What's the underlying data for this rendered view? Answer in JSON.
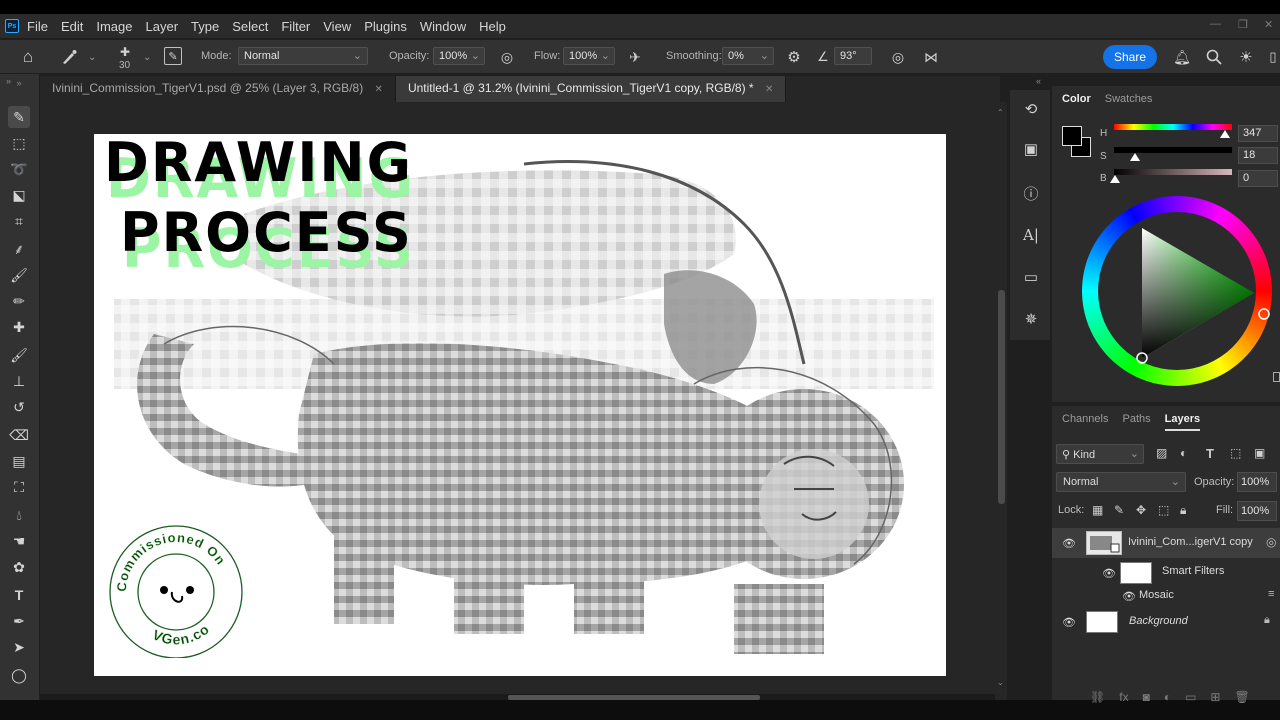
{
  "menubar": {
    "logo": "Ps",
    "items": [
      "File",
      "Edit",
      "Image",
      "Layer",
      "Type",
      "Select",
      "Filter",
      "View",
      "Plugins",
      "Window",
      "Help"
    ]
  },
  "options": {
    "brush_size": "30",
    "mode_label": "Mode:",
    "mode_value": "Normal",
    "opacity_label": "Opacity:",
    "opacity_value": "100%",
    "flow_label": "Flow:",
    "flow_value": "100%",
    "smoothing_label": "Smoothing:",
    "smoothing_value": "0%",
    "angle_value": "93°",
    "share_label": "Share"
  },
  "tabs": [
    {
      "label": "Ivinini_Commission_TigerV1.psd @ 25% (Layer 3, RGB/8)",
      "active": false
    },
    {
      "label": "Untitled-1 @ 31.2% (Ivinini_Commission_TigerV1 copy, RGB/8) *",
      "active": true
    }
  ],
  "canvas": {
    "title_line1": "DRAWING",
    "title_line2": "PROCESS",
    "badge_top": "Commissioned On",
    "badge_bottom": "VGen.co"
  },
  "color_panel": {
    "tabs": [
      "Color",
      "Swatches"
    ],
    "h_label": "H",
    "h_value": "347",
    "s_label": "S",
    "s_value": "18",
    "b_label": "B",
    "b_value": "0"
  },
  "layers_panel": {
    "tabs": [
      "Channels",
      "Paths",
      "Layers"
    ],
    "kind_label": "Kind",
    "blend_mode": "Normal",
    "opacity_label": "Opacity:",
    "opacity_value": "100%",
    "lock_label": "Lock:",
    "fill_label": "Fill:",
    "fill_value": "100%",
    "layers": [
      {
        "name": "Ivinini_Com...igerV1 copy"
      },
      {
        "name": "Smart Filters"
      },
      {
        "name": "Mosaic"
      },
      {
        "name": "Background"
      }
    ]
  },
  "colors": {
    "accent": "#1473e6",
    "title_shadow": "#9cf5a4",
    "badge_ring": "#2e7d32"
  }
}
